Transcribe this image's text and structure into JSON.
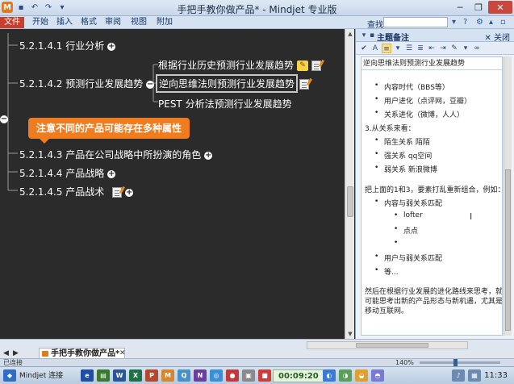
{
  "window": {
    "title": "手把手教你做产品* - Mindjet 专业版",
    "min": "─",
    "max": "❐",
    "close": "✕"
  },
  "ribbon": {
    "tabs": [
      "文件",
      "开始",
      "插入",
      "格式",
      "审阅",
      "视图",
      "附加"
    ],
    "find_label": "查找",
    "find_value": ""
  },
  "mindmap": {
    "topics": {
      "t1": "5.2.1.4.1 行业分析",
      "t2": "5.2.1.4.2 预测行业发展趋势",
      "t3": "5.2.1.4.3 产品在公司战略中所扮演的角色",
      "t4": "5.2.1.4.4 产品战略",
      "t5": "5.2.1.4.5 产品战术"
    },
    "subtopics": {
      "s1": "根据行业历史预测行业发展趋势",
      "s2": "逆向思维法则预测行业发展趋势",
      "s3": "PEST 分析法预测行业发展趋势"
    },
    "callout": "注意不同的产品可能存在多种属性",
    "add": "+",
    "collapse": "−"
  },
  "notes_panel": {
    "title": "主题备注",
    "close_label": "✕ 关闭",
    "topic": "逆向思维法则预测行业发展趋势",
    "lines": {
      "l1": "内容时代（BBS等）",
      "l2": "用户进化（点评网，豆瓣）",
      "l3": "关系进化（微博，人人）",
      "l4": "3.从关系来看：",
      "l5": "陌生关系 陌陌",
      "l6": "强关系 qq空间",
      "l7": "弱关系 新浪微博",
      "l8": "把上面的1和3，要素打乱重新组合，例如：",
      "l9": "内容与弱关系匹配",
      "l10": "lofter",
      "l11": "点点",
      "l12": "用户与弱关系匹配",
      "l13": "等...",
      "l14": "然后在根据行业发展的进化路线来思考，就有",
      "l15": "可能思考出新的产品形态与新机遇，尤其是在",
      "l16": "移动互联网。"
    }
  },
  "doc_tab": {
    "label": "手把手教你做产品*",
    "nav_prev": "◀",
    "nav_next": "▶",
    "close": "✕"
  },
  "statusbar": {
    "connection": "已连接",
    "zoom": "140%"
  },
  "taskbar": {
    "app_label": "Mindjet 连接",
    "rec_time": "00:09:20",
    "clock": "11:33"
  },
  "colors": {
    "canvas_bg": "#2b2b2b",
    "callout": "#f07c20",
    "ribbon_file": "#c7402d"
  }
}
